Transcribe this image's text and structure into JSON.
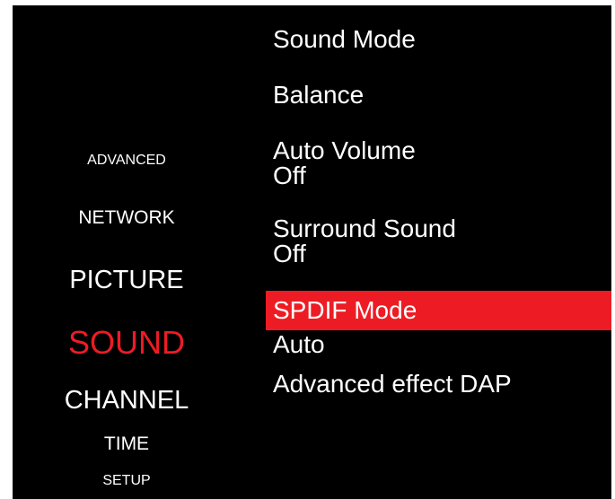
{
  "categories": {
    "advanced": "ADVANCED",
    "network": "NETWORK",
    "picture": "PICTURE",
    "sound": "SOUND",
    "channel": "CHANNEL",
    "time": "TIME",
    "setup": "SETUP"
  },
  "sound_menu": {
    "sound_mode": "Sound Mode",
    "balance": "Balance",
    "auto_volume": {
      "label": "Auto Volume",
      "value": "Off"
    },
    "surround_sound": {
      "label": "Surround Sound",
      "value": "Off"
    },
    "spdif_mode": {
      "label": "SPDIF Mode",
      "value": "Auto"
    },
    "advanced_effect": "Advanced effect DAP"
  },
  "colors": {
    "background": "#000000",
    "text": "#ffffff",
    "accent": "#ed1c24"
  }
}
